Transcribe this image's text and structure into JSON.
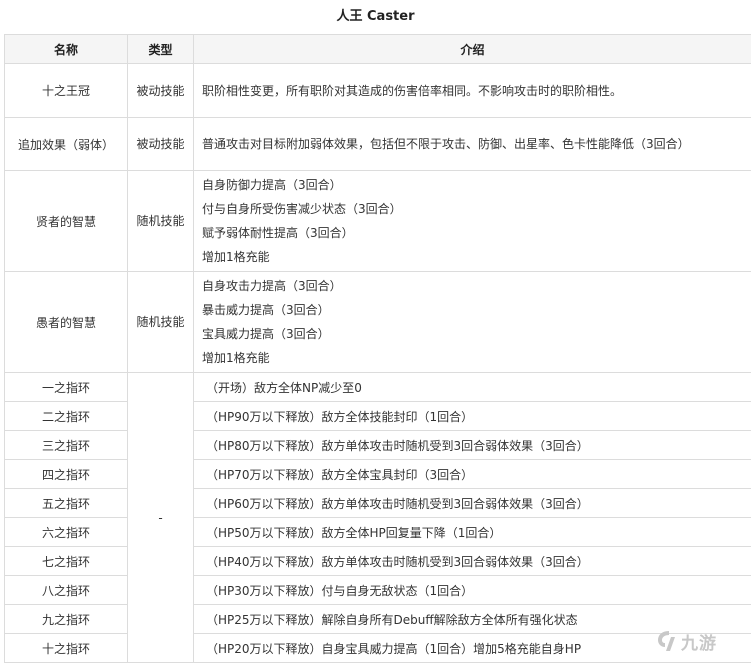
{
  "title": "人王 Caster",
  "headers": {
    "name": "名称",
    "type": "类型",
    "desc": "介绍"
  },
  "skills": [
    {
      "name": "十之王冠",
      "type": "被动技能",
      "lines": [
        "职阶相性变更，所有职阶对其造成的伤害倍率相同。不影响攻击时的职阶相性。"
      ]
    },
    {
      "name": "追加效果（弱体）",
      "type": "被动技能",
      "lines": [
        "普通攻击对目标附加弱体效果，包括但不限于攻击、防御、出星率、色卡性能降低（3回合）"
      ]
    },
    {
      "name": "贤者的智慧",
      "type": "随机技能",
      "lines": [
        "自身防御力提高（3回合）",
        "付与自身所受伤害减少状态（3回合）",
        "赋予弱体耐性提高（3回合）",
        "增加1格充能"
      ]
    },
    {
      "name": "愚者的智慧",
      "type": "随机技能",
      "lines": [
        "自身攻击力提高（3回合）",
        "暴击威力提高（3回合）",
        "宝具威力提高（3回合）",
        "增加1格充能"
      ]
    }
  ],
  "rings_type": "-",
  "rings": [
    {
      "name": "一之指环",
      "desc": "（开场）敌方全体NP减少至0"
    },
    {
      "name": "二之指环",
      "desc": "（HP90万以下释放）敌方全体技能封印（1回合）"
    },
    {
      "name": "三之指环",
      "desc": "（HP80万以下释放）敌方单体攻击时随机受到3回合弱体效果（3回合）"
    },
    {
      "name": "四之指环",
      "desc": "（HP70万以下释放）敌方全体宝具封印（3回合）"
    },
    {
      "name": "五之指环",
      "desc": "（HP60万以下释放）敌方单体攻击时随机受到3回合弱体效果（3回合）"
    },
    {
      "name": "六之指环",
      "desc": "（HP50万以下释放）敌方全体HP回复量下降（1回合）"
    },
    {
      "name": "七之指环",
      "desc": "（HP40万以下释放）敌方单体攻击时随机受到3回合弱体效果（3回合）"
    },
    {
      "name": "八之指环",
      "desc": "（HP30万以下释放）付与自身无敌状态（1回合）"
    },
    {
      "name": "九之指环",
      "desc": "（HP25万以下释放）解除自身所有Debuff解除敌方全体所有强化状态"
    },
    {
      "name": "十之指环",
      "desc": "（HP20万以下释放）自身宝具威力提高（1回合）增加5格充能自身HP"
    }
  ],
  "watermark": {
    "text": "九游",
    "icon": "jiuyou-logo-icon"
  }
}
